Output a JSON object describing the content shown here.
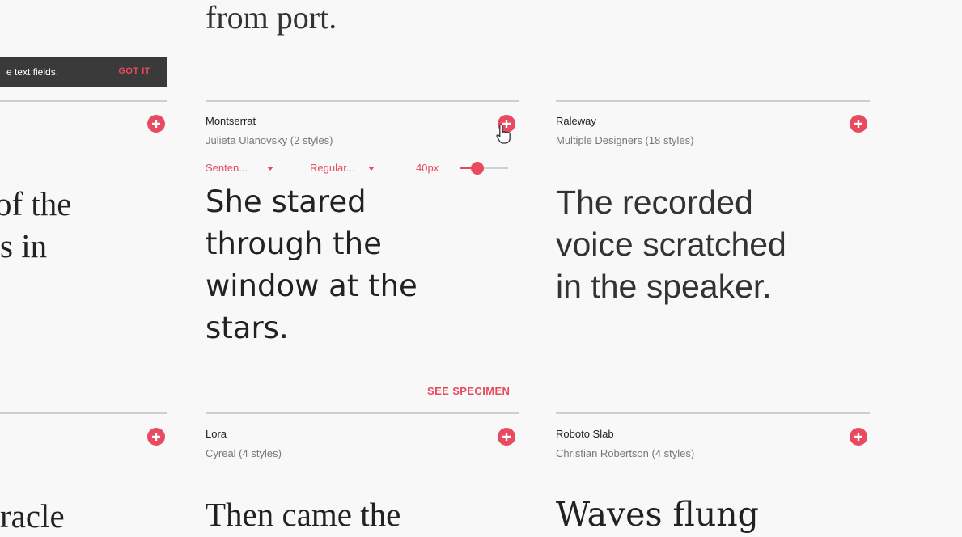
{
  "top_text": "from port.",
  "toast": {
    "message": "e text fields.",
    "action": "GOT IT"
  },
  "left_column": {
    "card1_sample": "of the\ns in",
    "card2_sample": "racle"
  },
  "cards": [
    {
      "name": "Montserrat",
      "meta": "Julieta Ulanovsky (2 styles)",
      "controls": {
        "text_mode": "Senten...",
        "style": "Regular...",
        "size": "40px",
        "size_level": 0.3
      },
      "sample": "She stared\nthrough the\nwindow at the\nstars.",
      "see_specimen": "SEE SPECIMEN"
    },
    {
      "name": "Raleway",
      "meta": "Multiple Designers (18 styles)",
      "sample": "The recorded\nvoice scratched\nin the speaker."
    },
    {
      "name": "Lora",
      "meta": "Cyreal (4 styles)",
      "sample": "Then came the"
    },
    {
      "name": "Roboto Slab",
      "meta": "Christian Robertson (4 styles)",
      "sample": "Waves flung"
    }
  ],
  "icons": {
    "add": "plus-circle-icon",
    "cursor": "hand-pointer-icon",
    "accent": "#e84a5f"
  }
}
